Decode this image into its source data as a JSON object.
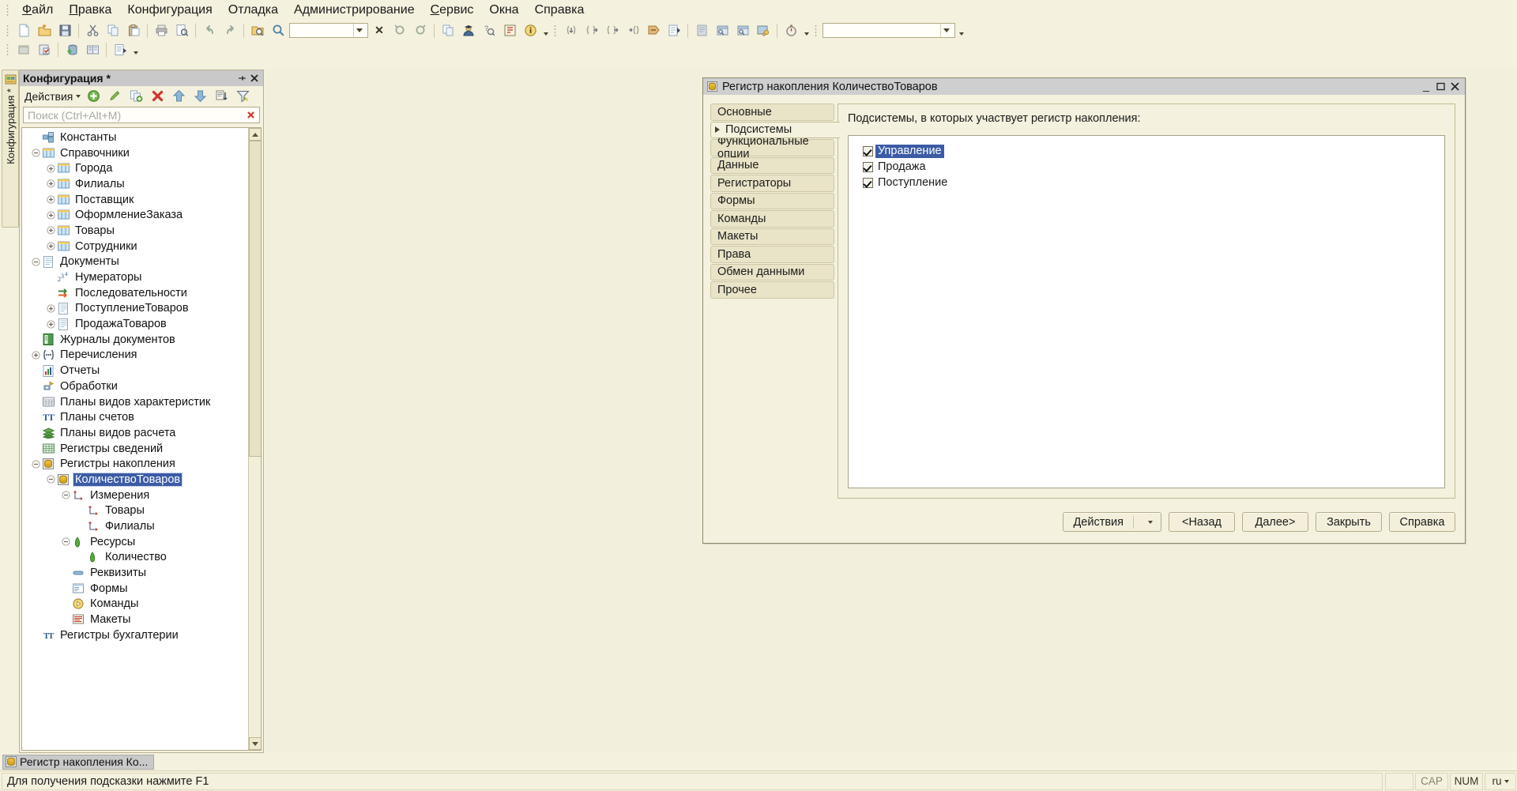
{
  "menubar": {
    "items": [
      {
        "label": "Файл",
        "accel": "Ф"
      },
      {
        "label": "Правка",
        "accel": "П"
      },
      {
        "label": "Конфигурация",
        "accel": ""
      },
      {
        "label": "Отладка",
        "accel": ""
      },
      {
        "label": "Администрирование",
        "accel": ""
      },
      {
        "label": "Сервис",
        "accel": "С"
      },
      {
        "label": "Окна",
        "accel": ""
      },
      {
        "label": "Справка",
        "accel": ""
      }
    ]
  },
  "toolbar_row1": {
    "buttons": [
      {
        "name": "new-document-icon",
        "title": "Новый"
      },
      {
        "name": "open-folder-icon",
        "title": "Открыть"
      },
      {
        "name": "save-icon",
        "title": "Сохранить"
      },
      {
        "name": "cut-icon",
        "title": "Вырезать"
      },
      {
        "name": "copy-icon",
        "title": "Копировать"
      },
      {
        "name": "paste-icon",
        "title": "Вставить"
      },
      {
        "name": "print-icon",
        "title": "Печать"
      },
      {
        "name": "print-preview-icon",
        "title": "Предварительный просмотр"
      },
      {
        "name": "undo-icon",
        "title": "Отменить"
      },
      {
        "name": "redo-icon",
        "title": "Вернуть"
      },
      {
        "name": "find-in-files-icon",
        "title": "Глобальный поиск"
      },
      {
        "name": "search-icon",
        "title": "Найти"
      },
      {
        "name": "find-next-icon",
        "title": "Найти следующий"
      },
      {
        "name": "find-prev-icon",
        "title": "Найти предыдущий"
      },
      {
        "name": "copy-window-icon",
        "title": "Копировать окно"
      },
      {
        "name": "user-config-icon",
        "title": "Пользователи"
      },
      {
        "name": "syntax-help-icon",
        "title": "Синтакс-помощник"
      },
      {
        "name": "content-icon",
        "title": "Содержание"
      },
      {
        "name": "info-icon",
        "title": "О программе"
      },
      {
        "name": "step-into-icon",
        "title": "Шагнуть в"
      },
      {
        "name": "step-over-icon",
        "title": "Шагнуть через"
      },
      {
        "name": "step-out-icon",
        "title": "Шагнуть из"
      },
      {
        "name": "run-to-cursor-icon",
        "title": "Идти до курсора"
      },
      {
        "name": "continue-debug-icon",
        "title": "Продолжить отладку"
      },
      {
        "name": "start-debug-icon",
        "title": "Начать отладку"
      },
      {
        "name": "breakpoint-icon",
        "title": "Точка останова"
      },
      {
        "name": "watch-window-icon",
        "title": "Табло"
      },
      {
        "name": "call-stack-icon",
        "title": "Стек вызовов"
      },
      {
        "name": "debug-settings-icon",
        "title": "Настройка отладки"
      },
      {
        "name": "performance-icon",
        "title": "Замер производительности"
      }
    ],
    "search_value": "",
    "combo_value": ""
  },
  "toolbar_row2": {
    "buttons": [
      {
        "name": "config-window-icon",
        "title": "Окно конфигурации"
      },
      {
        "name": "config-check-icon",
        "title": "Проверка конфигурации"
      },
      {
        "name": "database-config-icon",
        "title": "Конфигурация базы данных"
      },
      {
        "name": "compare-merge-icon",
        "title": "Сравнить, объединить"
      },
      {
        "name": "report-icon",
        "title": "Отчет по конфигурации"
      }
    ]
  },
  "dock_tab": {
    "label": "Конфигурация *",
    "icon": "configuration-icon"
  },
  "config_panel": {
    "title": "Конфигурация *",
    "pin_icon": "pin-icon",
    "close_icon": "close-icon",
    "actions_label": "Действия",
    "action_buttons": [
      {
        "name": "add-icon",
        "title": "Добавить"
      },
      {
        "name": "edit-icon",
        "title": "Изменить"
      },
      {
        "name": "copy-item-icon",
        "title": "Скопировать"
      },
      {
        "name": "delete-icon",
        "title": "Удалить"
      },
      {
        "name": "move-up-icon",
        "title": "Переместить вверх"
      },
      {
        "name": "move-down-icon",
        "title": "Переместить вниз"
      },
      {
        "name": "sort-icon",
        "title": "Сортировать"
      },
      {
        "name": "filter-icon",
        "title": "Отбор"
      }
    ],
    "search": {
      "placeholder": "Поиск (Ctrl+Alt+M)",
      "value": "",
      "clear_icon": "clear-icon"
    },
    "tree": [
      {
        "label": "Константы",
        "depth": 1,
        "expander": "none",
        "icon": "constants-icon",
        "selected": false
      },
      {
        "label": "Справочники",
        "depth": 1,
        "expander": "minus",
        "icon": "catalog-icon",
        "selected": false
      },
      {
        "label": "Города",
        "depth": 2,
        "expander": "plus",
        "icon": "catalog-icon",
        "selected": false
      },
      {
        "label": "Филиалы",
        "depth": 2,
        "expander": "plus",
        "icon": "catalog-icon",
        "selected": false
      },
      {
        "label": "Поставщик",
        "depth": 2,
        "expander": "plus",
        "icon": "catalog-icon",
        "selected": false
      },
      {
        "label": "ОформлениеЗаказа",
        "depth": 2,
        "expander": "plus",
        "icon": "catalog-icon",
        "selected": false
      },
      {
        "label": "Товары",
        "depth": 2,
        "expander": "plus",
        "icon": "catalog-icon",
        "selected": false
      },
      {
        "label": "Сотрудники",
        "depth": 2,
        "expander": "plus",
        "icon": "catalog-icon",
        "selected": false
      },
      {
        "label": "Документы",
        "depth": 1,
        "expander": "minus",
        "icon": "document-icon",
        "selected": false
      },
      {
        "label": "Нумераторы",
        "depth": 2,
        "expander": "none",
        "icon": "numerator-icon",
        "selected": false
      },
      {
        "label": "Последовательности",
        "depth": 2,
        "expander": "none",
        "icon": "sequence-icon",
        "selected": false
      },
      {
        "label": "ПоступлениеТоваров",
        "depth": 2,
        "expander": "plus",
        "icon": "document-icon",
        "selected": false
      },
      {
        "label": "ПродажаТоваров",
        "depth": 2,
        "expander": "plus",
        "icon": "document-icon",
        "selected": false
      },
      {
        "label": "Журналы документов",
        "depth": 1,
        "expander": "none",
        "icon": "journal-icon",
        "selected": false
      },
      {
        "label": "Перечисления",
        "depth": 1,
        "expander": "plus",
        "icon": "enum-icon",
        "selected": false
      },
      {
        "label": "Отчеты",
        "depth": 1,
        "expander": "none",
        "icon": "report-icon",
        "selected": false
      },
      {
        "label": "Обработки",
        "depth": 1,
        "expander": "none",
        "icon": "dataprocessor-icon",
        "selected": false
      },
      {
        "label": "Планы видов характеристик",
        "depth": 1,
        "expander": "none",
        "icon": "chart-of-characteristic-icon",
        "selected": false
      },
      {
        "label": "Планы счетов",
        "depth": 1,
        "expander": "none",
        "icon": "chart-of-accounts-icon",
        "selected": false
      },
      {
        "label": "Планы видов расчета",
        "depth": 1,
        "expander": "none",
        "icon": "calculation-types-icon",
        "selected": false
      },
      {
        "label": "Регистры сведений",
        "depth": 1,
        "expander": "none",
        "icon": "information-register-icon",
        "selected": false
      },
      {
        "label": "Регистры накопления",
        "depth": 1,
        "expander": "minus",
        "icon": "accumulation-register-icon",
        "selected": false
      },
      {
        "label": "КоличествоТоваров",
        "depth": 2,
        "expander": "minus",
        "icon": "accumulation-register-icon",
        "selected": true
      },
      {
        "label": "Измерения",
        "depth": 3,
        "expander": "minus",
        "icon": "dimension-icon",
        "selected": false
      },
      {
        "label": "Товары",
        "depth": 4,
        "expander": "none",
        "icon": "dimension-icon",
        "selected": false
      },
      {
        "label": "Филиалы",
        "depth": 4,
        "expander": "none",
        "icon": "dimension-icon",
        "selected": false
      },
      {
        "label": "Ресурсы",
        "depth": 3,
        "expander": "minus",
        "icon": "resource-icon",
        "selected": false
      },
      {
        "label": "Количество",
        "depth": 4,
        "expander": "none",
        "icon": "resource-icon",
        "selected": false
      },
      {
        "label": "Реквизиты",
        "depth": 3,
        "expander": "none",
        "icon": "attribute-icon",
        "selected": false
      },
      {
        "label": "Формы",
        "depth": 3,
        "expander": "none",
        "icon": "form-icon",
        "selected": false
      },
      {
        "label": "Команды",
        "depth": 3,
        "expander": "none",
        "icon": "command-icon",
        "selected": false
      },
      {
        "label": "Макеты",
        "depth": 3,
        "expander": "none",
        "icon": "template-icon",
        "selected": false
      },
      {
        "label": "Регистры бухгалтерии",
        "depth": 1,
        "expander": "none",
        "icon": "accounting-register-icon",
        "selected": false
      }
    ]
  },
  "dialog": {
    "title": "Регистр накопления КоличествоТоваров",
    "title_icon": "accumulation-register-icon",
    "window_buttons": {
      "minimize": "_",
      "maximize": "❐",
      "close": "✕"
    },
    "tabs": [
      {
        "label": "Основные",
        "active": false
      },
      {
        "label": "Подсистемы",
        "active": true
      },
      {
        "label": "Функциональные опции",
        "active": false
      },
      {
        "label": "Данные",
        "active": false
      },
      {
        "label": "Регистраторы",
        "active": false
      },
      {
        "label": "Формы",
        "active": false
      },
      {
        "label": "Команды",
        "active": false
      },
      {
        "label": "Макеты",
        "active": false
      },
      {
        "label": "Права",
        "active": false
      },
      {
        "label": "Обмен данными",
        "active": false
      },
      {
        "label": "Прочее",
        "active": false
      }
    ],
    "content": {
      "caption": "Подсистемы, в которых участвует регистр накопления:",
      "items": [
        {
          "label": "Управление",
          "checked": true,
          "selected": true
        },
        {
          "label": "Продажа",
          "checked": true,
          "selected": false
        },
        {
          "label": "Поступление",
          "checked": true,
          "selected": false
        }
      ]
    },
    "buttons": [
      {
        "label": "Действия",
        "name": "actions-button",
        "split": true
      },
      {
        "label": "<Назад",
        "name": "back-button",
        "split": false
      },
      {
        "label": "Далее>",
        "name": "next-button",
        "split": false
      },
      {
        "label": "Закрыть",
        "name": "close-button",
        "split": false
      },
      {
        "label": "Справка",
        "name": "help-button",
        "split": false
      }
    ]
  },
  "taskbar": {
    "items": [
      {
        "label": "Регистр накопления Ко...",
        "icon": "accumulation-register-icon"
      }
    ]
  },
  "statusbar": {
    "message": "Для получения подсказки нажмите F1",
    "cells": [
      {
        "label": "",
        "name": "status-blank",
        "active": false
      },
      {
        "label": "CAP",
        "name": "caps-lock-indicator",
        "active": false
      },
      {
        "label": "NUM",
        "name": "num-lock-indicator",
        "active": true
      },
      {
        "label": "ru",
        "name": "language-indicator",
        "active": true
      }
    ]
  },
  "colors": {
    "chrome": "#f4f1de",
    "titlebar": "#cfcfcf",
    "selection": "#3b5ba5",
    "accent": "#e9e4c8"
  }
}
